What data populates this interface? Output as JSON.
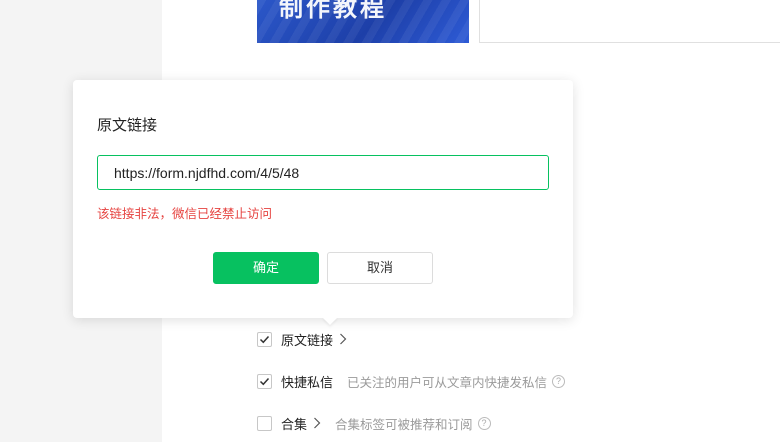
{
  "cover": {
    "text": "制作教程"
  },
  "dialog": {
    "title": "原文链接",
    "url_value": "https://form.njdfhd.com/4/5/48",
    "error_message": "该链接非法，微信已经禁止访问",
    "confirm_label": "确定",
    "cancel_label": "取消"
  },
  "options": [
    {
      "label": "原文链接",
      "checked": true,
      "description": ""
    },
    {
      "label": "快捷私信",
      "checked": true,
      "description": "已关注的用户可从文章内快捷发私信"
    },
    {
      "label": "合集",
      "checked": false,
      "description": "合集标签可被推荐和订阅"
    }
  ],
  "colors": {
    "accent": "#07c160",
    "error": "#e64340"
  }
}
